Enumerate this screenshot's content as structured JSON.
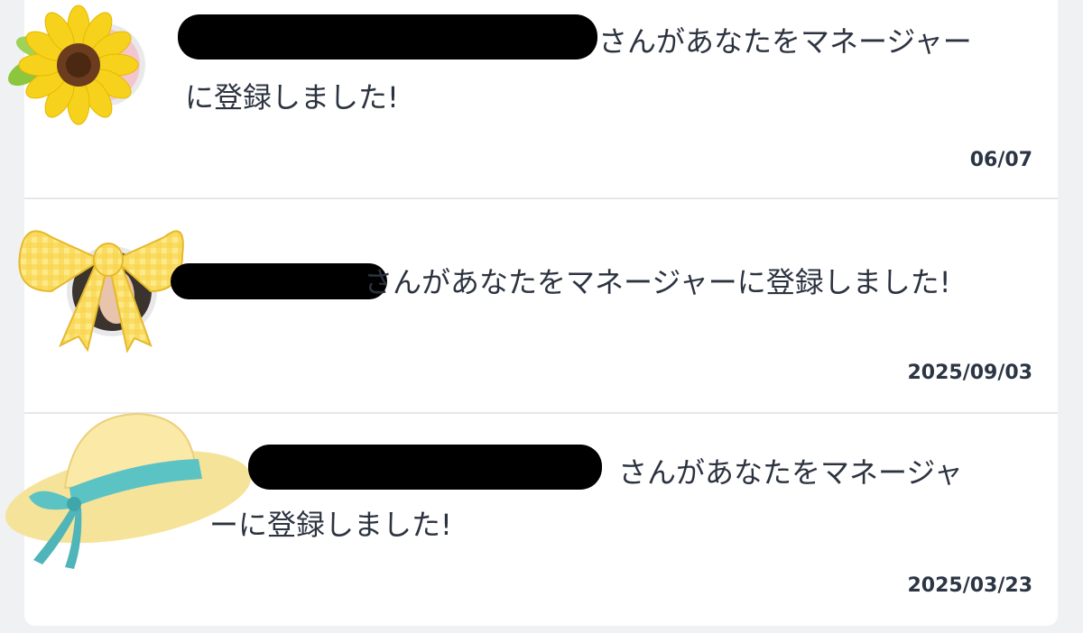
{
  "notifications": [
    {
      "message_line1": "さんがあなたをマネージャー",
      "message_line2": "に登録しました!",
      "date": "06/07",
      "avatar_frame": "sunflower-icon"
    },
    {
      "message_line1": "さんがあなたをマネージャーに登録しました!",
      "date": "2025/09/03",
      "avatar_frame": "ribbon-bow-icon"
    },
    {
      "message_line1": "さんがあなたをマネージャ",
      "message_line2": "ーに登録しました!",
      "date": "2025/03/23",
      "avatar_frame": "straw-hat-icon"
    }
  ],
  "colors": {
    "background": "#f0f1f3",
    "card": "#ffffff",
    "text": "#2c3340",
    "date_text": "#2b3544",
    "divider": "#e6e7ea"
  }
}
